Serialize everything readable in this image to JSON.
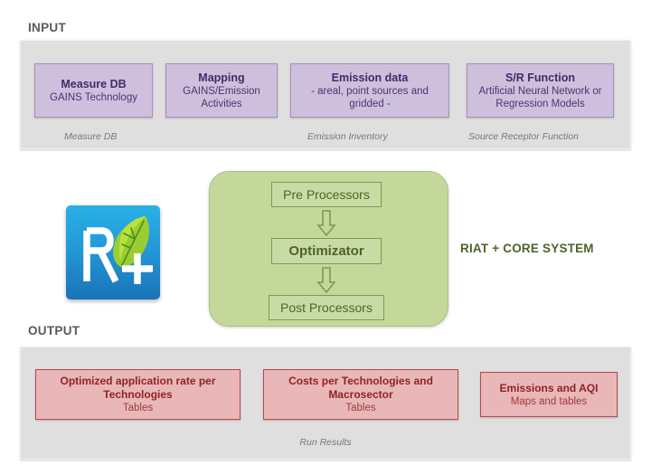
{
  "input": {
    "heading": "INPUT",
    "boxes": [
      {
        "title": "Measure DB",
        "sub": "GAINS Technology"
      },
      {
        "title": "Mapping",
        "sub": "GAINS/Emission Activities"
      },
      {
        "title": "Emission data",
        "sub": "- areal, point sources and gridded -"
      },
      {
        "title": "S/R Function",
        "sub": "Artificial Neural Network or Regression Models"
      }
    ],
    "captions": [
      "Measure DB",
      "Emission Inventory",
      "Source Receptor Function"
    ]
  },
  "core": {
    "label": "RIAT + CORE SYSTEM",
    "steps": [
      {
        "name": "Pre Processors"
      },
      {
        "name": "Optimizator"
      },
      {
        "name": "Post Processors"
      }
    ]
  },
  "logo": {
    "text": "R+",
    "name": "riat-plus-logo"
  },
  "output": {
    "heading": "OUTPUT",
    "boxes": [
      {
        "title": "Optimized application rate per Technologies",
        "sub": "Tables"
      },
      {
        "title": "Costs per Technologies and Macrosector",
        "sub": "Tables"
      },
      {
        "title": "Emissions and AQI",
        "sub": "Maps and tables"
      }
    ],
    "caption": "Run Results"
  },
  "colors": {
    "panel_grey": "#dfdfdf",
    "input_purple": "#cec0dc",
    "input_purple_border": "#a98cc4",
    "core_green": "#c4d89b",
    "core_green_border": "#7d9a4e",
    "output_pink": "#e9b7b7",
    "output_pink_border": "#b5484b",
    "logo_blue": "#2399d8",
    "logo_leaf_green": "#8dc63f"
  }
}
